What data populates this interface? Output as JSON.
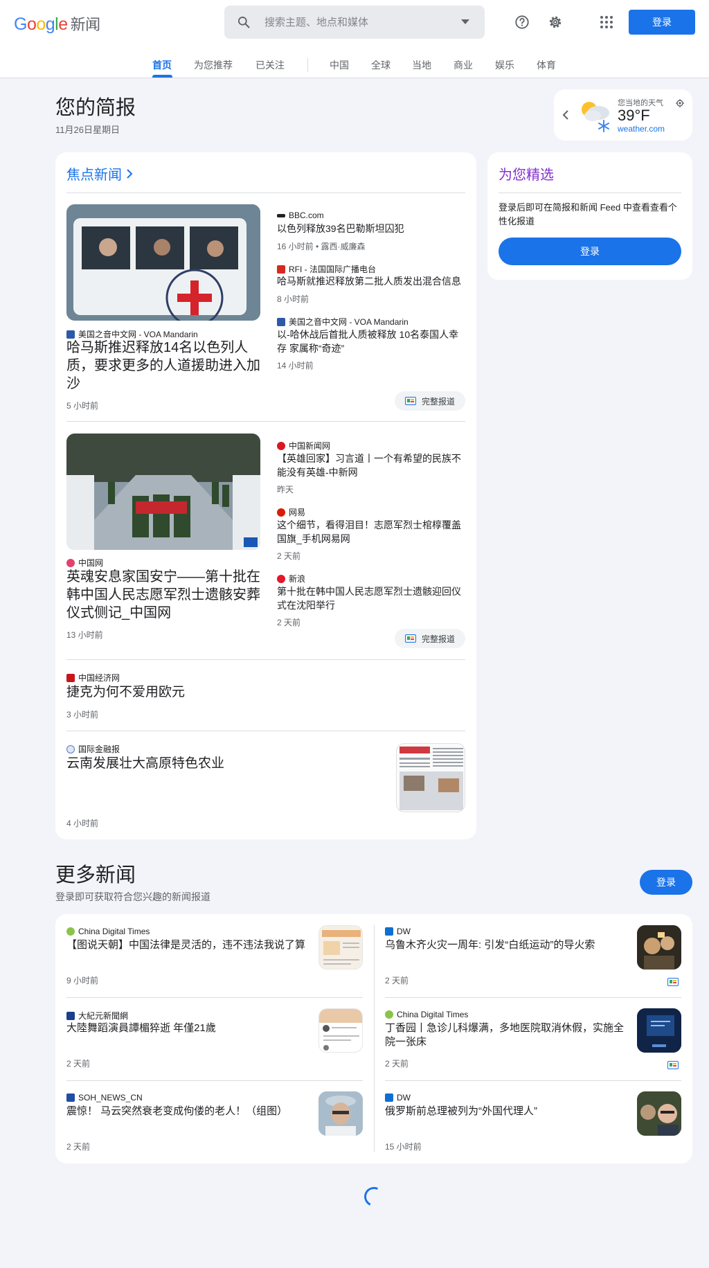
{
  "header": {
    "logo_letters": [
      "G",
      "o",
      "o",
      "g",
      "l",
      "e"
    ],
    "logo_suffix": "新闻",
    "search_placeholder": "搜索主题、地点和媒体",
    "signin_label": "登录"
  },
  "nav": {
    "tabs": [
      "首页",
      "为您推荐",
      "已关注"
    ],
    "sections": [
      "中国",
      "全球",
      "当地",
      "商业",
      "娱乐",
      "体育"
    ]
  },
  "briefing": {
    "title": "您的简报",
    "date": "11月26日星期日"
  },
  "weather": {
    "label": "您当地的天气",
    "temp": "39°F",
    "source": "weather.com"
  },
  "top_stories": {
    "heading": "焦点新闻",
    "clusters": [
      {
        "main": {
          "source": "美国之音中文网 - VOA Mandarin",
          "title": "哈马斯推迟释放14名以色列人质，要求更多的人道援助进入加沙",
          "time": "5 小时前"
        },
        "related": [
          {
            "source": "BBC.com",
            "title": "以色列释放39名巴勒斯坦囚犯",
            "time": "16 小时前 • 露西·威廉森"
          },
          {
            "source": "RFI - 法国国际广播电台",
            "title": "哈马斯就推迟释放第二批人质发出混合信息",
            "time": "8 小时前"
          },
          {
            "source": "美国之音中文网 - VOA Mandarin",
            "title": "以-哈休战后首批人质被释放 10名泰国人幸存 家属称“奇迹”",
            "time": "14 小时前"
          }
        ],
        "full_coverage": "完整报道"
      },
      {
        "main": {
          "source": "中国网",
          "title": "英魂安息家国安宁——第十批在韩中国人民志愿军烈士遗骸安葬仪式侧记_中国网",
          "time": "13 小时前"
        },
        "related": [
          {
            "source": "中国新闻网",
            "title": "【英雄回家】习言道丨一个有希望的民族不能没有英雄-中新网",
            "time": "昨天"
          },
          {
            "source": "网易",
            "title": "这个细节，看得泪目！志愿军烈士棺椁覆盖国旗_手机网易网",
            "time": "2 天前"
          },
          {
            "source": "新浪",
            "title": "第十批在韩中国人民志愿军烈士遗骸迎回仪式在沈阳举行",
            "time": "2 天前"
          }
        ],
        "full_coverage": "完整报道"
      }
    ],
    "singles": [
      {
        "source": "中国经济网",
        "title": "捷克为何不爱用欧元",
        "time": "3 小时前"
      },
      {
        "source": "国际金融报",
        "title": "云南发展壮大高原特色农业",
        "time": "4 小时前"
      }
    ]
  },
  "picks": {
    "heading": "为您精选",
    "text": "登录后即可在简报和新闻 Feed 中查看查看个性化报道",
    "signin_label": "登录"
  },
  "more_news": {
    "title": "更多新闻",
    "subtitle": "登录即可获取符合您兴趣的新闻报道",
    "signin_label": "登录",
    "left": [
      {
        "source": "China Digital Times",
        "title": "【图说天朝】中国法律是灵活的，违不违法我说了算",
        "time": "9 小时前"
      },
      {
        "source": "大紀元新聞網",
        "title": "大陸舞蹈演員譚楣猝逝 年僅21歲",
        "time": "2 天前"
      },
      {
        "source": "SOH_NEWS_CN",
        "title": "震惊！ 马云突然衰老变成佝偻的老人！（组图）",
        "time": "2 天前"
      }
    ],
    "right": [
      {
        "source": "DW",
        "title": "乌鲁木齐火灾一周年: 引发“白纸运动”的导火索",
        "time": "2 天前"
      },
      {
        "source": "China Digital Times",
        "title": "丁香园丨急诊儿科爆满，多地医院取消休假，实施全院一张床",
        "time": "2 天前"
      },
      {
        "source": "DW",
        "title": "俄罗斯前总理被列为“外国代理人”",
        "time": "15 小时前"
      }
    ]
  },
  "colors": {
    "accent": "#1a73e8",
    "background": "#f3f4f9"
  }
}
